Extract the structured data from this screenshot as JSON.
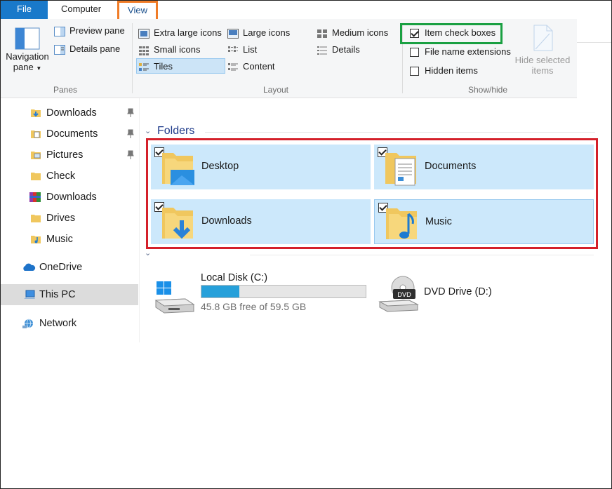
{
  "tabs": {
    "file": "File",
    "computer": "Computer",
    "view": "View"
  },
  "ribbon": {
    "panes": {
      "navigation_pane": [
        "Navigation",
        "pane"
      ],
      "preview_pane": "Preview pane",
      "details_pane": "Details pane",
      "label": "Panes"
    },
    "layout": {
      "extra_large_icons": "Extra large icons",
      "large_icons": "Large icons",
      "medium_icons": "Medium icons",
      "small_icons": "Small icons",
      "list": "List",
      "details": "Details",
      "tiles": "Tiles",
      "content": "Content",
      "label": "Layout"
    },
    "show_hide": {
      "item_check_boxes": {
        "label": "Item check boxes",
        "checked": true
      },
      "file_name_extensions": {
        "label": "File name extensions",
        "checked": false
      },
      "hidden_items": {
        "label": "Hidden items",
        "checked": false
      },
      "hide_selected_items": [
        "Hide selected",
        "items"
      ],
      "label": "Show/hide"
    }
  },
  "nav": {
    "items": [
      {
        "label": "Downloads",
        "pinned": true
      },
      {
        "label": "Documents",
        "pinned": true
      },
      {
        "label": "Pictures",
        "pinned": true
      },
      {
        "label": "Check"
      },
      {
        "label": "Downloads"
      },
      {
        "label": "Drives"
      },
      {
        "label": "Music"
      },
      {
        "label": "OneDrive"
      },
      {
        "label": "This PC",
        "selected": true
      },
      {
        "label": "Network"
      }
    ]
  },
  "content": {
    "folders_title": "Folders",
    "folders": [
      {
        "name": "Desktop",
        "checked": true
      },
      {
        "name": "Documents",
        "checked": true
      },
      {
        "name": "Downloads",
        "checked": true
      },
      {
        "name": "Music",
        "checked": true
      }
    ],
    "drives": [
      {
        "name": "Local Disk (C:)",
        "free": "45.8 GB free of 59.5 GB",
        "used_fraction": 0.23
      },
      {
        "name": "DVD Drive (D:)"
      }
    ]
  },
  "colors": {
    "accent": "#1979ca",
    "highlight_view_tab": "#f07c27",
    "highlight_checkbox": "#1aa042",
    "highlight_folders": "#d4202a",
    "tile_bg": "#cce8fb"
  }
}
